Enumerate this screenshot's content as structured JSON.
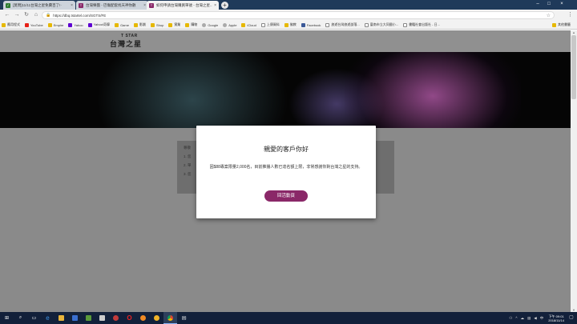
{
  "browser": {
    "tabs": [
      {
        "label": "[莫問]11/11台灣之星免費百了!·",
        "favicon_color": "#2e7d32"
      },
      {
        "label": "台灣樂團 - 巴傷配套找天神你數",
        "favicon_color": "#8a2868"
      },
      {
        "label": "如何申請台灣購買單號 - 台灣之星...",
        "favicon_color": "#8a2868"
      }
    ],
    "new_tab": "+",
    "url": "https://dbq.tstartel.com/SGTS/FE",
    "bookmarks": [
      {
        "label": "應用程式",
        "type": "apps"
      },
      {
        "label": "YouTube",
        "type": "yt"
      },
      {
        "label": "Empire",
        "type": "folder"
      },
      {
        "label": "Yahoo",
        "type": "yh"
      },
      {
        "label": "Yahoo!奇摩",
        "type": "yh"
      },
      {
        "label": "Game",
        "type": "folder"
      },
      {
        "label": "影劇",
        "type": "folder"
      },
      {
        "label": "Shop",
        "type": "folder"
      },
      {
        "label": "實業",
        "type": "folder"
      },
      {
        "label": "購物",
        "type": "folder"
      },
      {
        "label": "Google",
        "type": "gg"
      },
      {
        "label": "Apple",
        "type": "gg"
      },
      {
        "label": "iCloud",
        "type": "folder"
      },
      {
        "label": "上傳資料",
        "type": "pg"
      },
      {
        "label": "佛教",
        "type": "folder"
      },
      {
        "label": "Facebook",
        "type": "fb"
      },
      {
        "label": "旅遊台灣旅遊部落...",
        "type": "pg"
      },
      {
        "label": "臺南市立大同國小...",
        "type": "pg"
      },
      {
        "label": "書籍社會出版社 - 日...",
        "type": "pg"
      }
    ],
    "other_bookmarks": "其他書籤"
  },
  "page": {
    "logo_top": "T STAR",
    "logo_main": "台灣之星",
    "bg_heading": "尊敬",
    "bg_items": [
      "1. 您",
      "2. 單",
      "3. 您"
    ]
  },
  "modal": {
    "title": "親愛的客戶你好",
    "message": "因$88專案限量2,000名，目前推播人數已達名額上限，非常感謝你對台灣之星的支持。",
    "button": "回活動頁"
  },
  "taskbar": {
    "time": "下午 09:01",
    "date": "2018/11/14"
  }
}
